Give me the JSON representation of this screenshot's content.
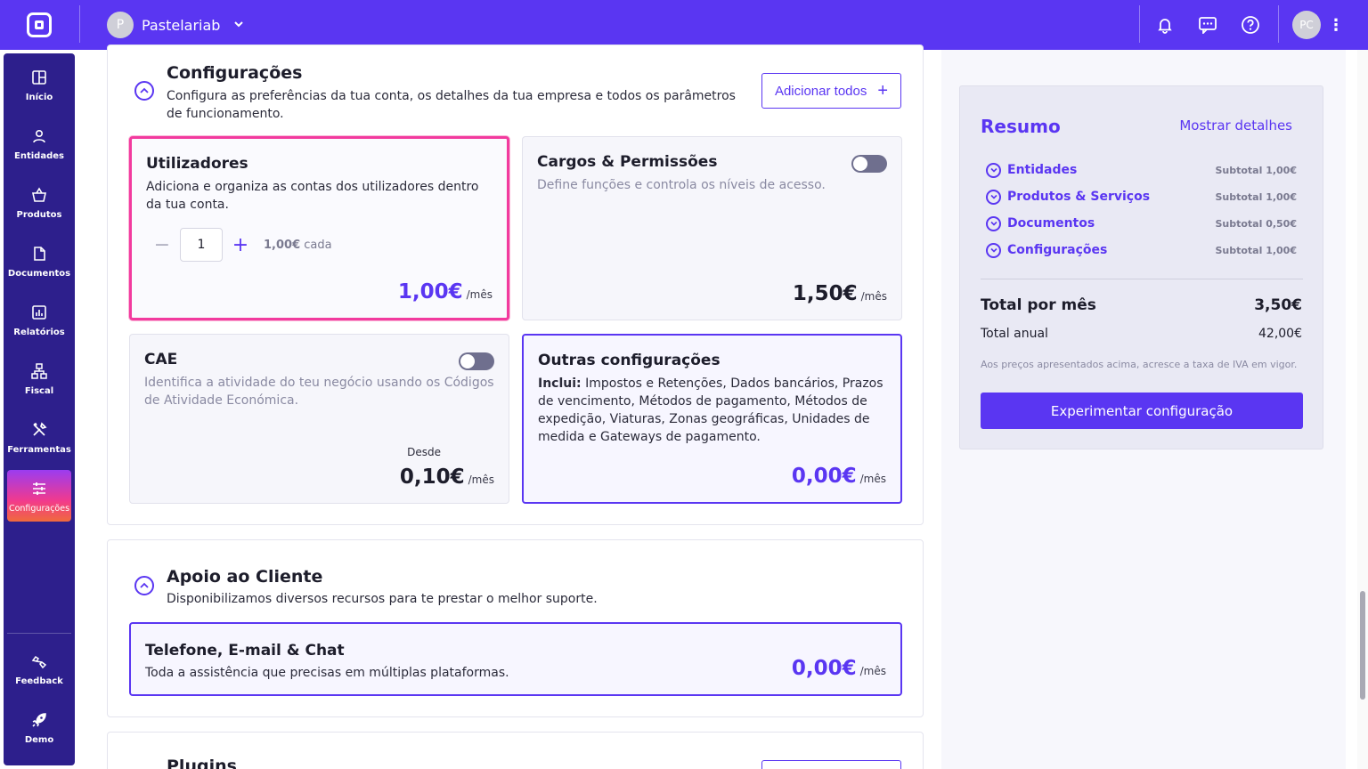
{
  "topbar": {
    "company_initial": "P",
    "company_name": "Pastelariab",
    "user_initials": "PC"
  },
  "sidebar": {
    "items": [
      {
        "label": "Início",
        "icon": "grid-icon"
      },
      {
        "label": "Entidades",
        "icon": "user-icon"
      },
      {
        "label": "Produtos",
        "icon": "basket-icon"
      },
      {
        "label": "Documentos",
        "icon": "document-icon"
      },
      {
        "label": "Relatórios",
        "icon": "chart-icon"
      },
      {
        "label": "Fiscal",
        "icon": "hierarchy-icon"
      },
      {
        "label": "Ferramentas",
        "icon": "tools-icon"
      },
      {
        "label": "Configurações",
        "icon": "sliders-icon"
      }
    ],
    "bottom": [
      {
        "label": "Feedback",
        "icon": "feedback-icon"
      },
      {
        "label": "Demo",
        "icon": "rocket-icon"
      }
    ]
  },
  "config_section": {
    "title": "Configurações",
    "description": "Configura as preferências da tua conta, os detalhes da tua empresa e todos os parâmetros de funcionamento.",
    "add_all_label": "Adicionar todos",
    "cards": {
      "users": {
        "title": "Utilizadores",
        "description": "Adiciona e organiza as contas dos utilizadores dentro da tua conta.",
        "quantity": "1",
        "unit_price": "1,00€",
        "unit_suffix": "cada",
        "price": "1,00€",
        "period": "/mês"
      },
      "roles": {
        "title": "Cargos & Permissões",
        "description": "Define funções e controla os níveis de acesso.",
        "price": "1,50€",
        "period": "/mês"
      },
      "cae": {
        "title": "CAE",
        "description": "Identifica a atividade do teu negócio usando os Códigos de Atividade Económica.",
        "from_label": "Desde",
        "price": "0,10€",
        "period": "/mês"
      },
      "other": {
        "title": "Outras configurações",
        "includes_label": "Inclui:",
        "description": "Impostos e Retenções, Dados bancários, Prazos de vencimento, Métodos de pagamento, Métodos de expedição, Viaturas, Zonas geográficas, Unidades de medida e Gateways de pagamento.",
        "price": "0,00€",
        "period": "/mês"
      }
    }
  },
  "support_section": {
    "title": "Apoio ao Cliente",
    "description": "Disponibilizamos diversos recursos para te prestar o melhor suporte.",
    "card": {
      "title": "Telefone, E-mail & Chat",
      "description": "Toda a assistência que precisas em múltiplas plataformas.",
      "price": "0,00€",
      "period": "/mês"
    }
  },
  "plugins_section": {
    "title": "Plugins"
  },
  "summary": {
    "title": "Resumo",
    "details_link": "Mostrar detalhes",
    "rows": [
      {
        "name": "Entidades",
        "subtotal": "Subtotal 1,00€"
      },
      {
        "name": "Produtos & Serviços",
        "subtotal": "Subtotal 1,00€"
      },
      {
        "name": "Documentos",
        "subtotal": "Subtotal 0,50€"
      },
      {
        "name": "Configurações",
        "subtotal": "Subtotal 1,00€"
      }
    ],
    "total_label": "Total por mês",
    "total_value": "3,50€",
    "annual_label": "Total anual",
    "annual_value": "42,00€",
    "vat_note": "Aos preços apresentados acima, acresce a taxa de IVA em vigor.",
    "cta_label": "Experimentar configuração"
  },
  "colors": {
    "brand": "#5a36f2",
    "sidebar": "#2d1f8c",
    "highlight": "#f23a9e"
  }
}
